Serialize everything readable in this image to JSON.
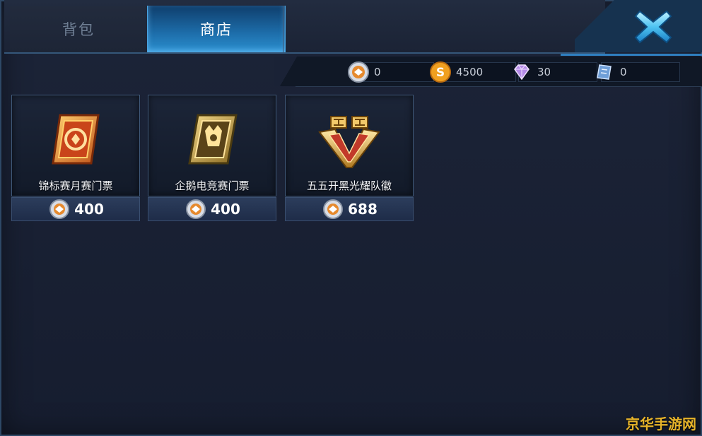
{
  "tabs": [
    {
      "label": "背包",
      "active": false
    },
    {
      "label": "商店",
      "active": true
    }
  ],
  "currencies": [
    {
      "icon": "ticket-coin-icon",
      "value": "0"
    },
    {
      "icon": "gold-coin-icon",
      "value": "4500"
    },
    {
      "icon": "diamond-icon",
      "value": "30"
    },
    {
      "icon": "voucher-icon",
      "value": "0"
    }
  ],
  "items": [
    {
      "name": "锦标赛月赛门票",
      "price": "400",
      "icon": "tournament-ticket-icon"
    },
    {
      "name": "企鹅电竞赛门票",
      "price": "400",
      "icon": "penguin-esports-ticket-icon"
    },
    {
      "name": "五五开黑光耀队徽",
      "price": "688",
      "icon": "team-badge-icon"
    }
  ],
  "watermark": "京华手游网",
  "colors": {
    "accent": "#2b90d0",
    "gold": "#e6b32a",
    "background": "#1a2236"
  }
}
